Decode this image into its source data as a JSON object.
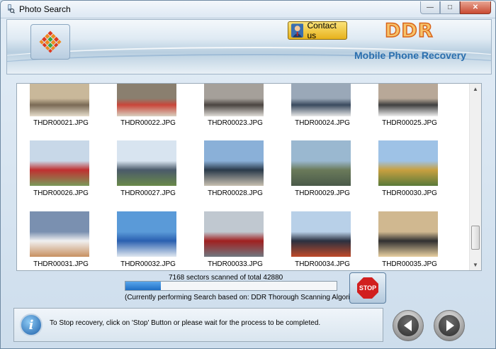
{
  "window": {
    "title": "Photo Search"
  },
  "header": {
    "contact_label": "Contact us",
    "brand": "DDR",
    "subtitle": "Mobile Phone Recovery"
  },
  "thumbnails": [
    {
      "name": "THDR00021.JPG"
    },
    {
      "name": "THDR00022.JPG"
    },
    {
      "name": "THDR00023.JPG"
    },
    {
      "name": "THDR00024.JPG"
    },
    {
      "name": "THDR00025.JPG"
    },
    {
      "name": "THDR00026.JPG"
    },
    {
      "name": "THDR00027.JPG"
    },
    {
      "name": "THDR00028.JPG"
    },
    {
      "name": "THDR00029.JPG"
    },
    {
      "name": "THDR00030.JPG"
    },
    {
      "name": "THDR00031.JPG"
    },
    {
      "name": "THDR00032.JPG"
    },
    {
      "name": "THDR00033.JPG"
    },
    {
      "name": "THDR00034.JPG"
    },
    {
      "name": "THDR00035.JPG"
    }
  ],
  "scan": {
    "status": "7168 sectors scanned of total 42880",
    "sectors_scanned": 7168,
    "sectors_total": 42880,
    "algorithm_text": "(Currently performing Search based on:  DDR Thorough Scanning Algorithm)"
  },
  "stop_label": "STOP",
  "footer": {
    "message": "To Stop recovery, click on 'Stop' Button or please wait for the process to be completed."
  },
  "colors": {
    "accent": "#1f6fc4",
    "brand_fill": "#f6c36a",
    "brand_stroke": "#d9631a",
    "subtitle": "#2a6fae",
    "stop": "#d11f1f"
  },
  "icons": {
    "app": "photo-search-icon",
    "logo": "ddr-logo-icon",
    "contact": "person-icon",
    "info": "info-icon",
    "stop": "stop-sign-icon",
    "back": "back-arrow-icon",
    "next": "next-arrow-icon"
  }
}
